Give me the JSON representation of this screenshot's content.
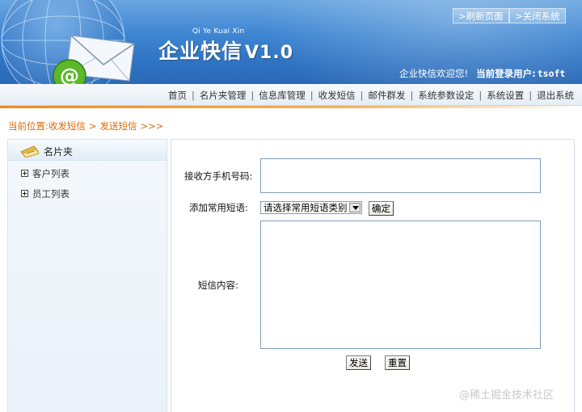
{
  "header": {
    "logo_pinyin": "Qi Ye Kuai Xin",
    "logo_title": "企业快信",
    "logo_version": "V1.0",
    "refresh_label": ">刷新页面",
    "close_label": ">关闭系统",
    "welcome_text": "企业快信欢迎您!",
    "login_label": "当前登录用户:",
    "username": "tsoft",
    "icons": [
      "globe-icon",
      "envelope-icon",
      "at-sign-icon"
    ]
  },
  "nav": {
    "items": [
      "首页",
      "名片夹管理",
      "信息库管理",
      "收发短信",
      "邮件群发",
      "系统参数设定",
      "系统设置",
      "退出系统"
    ],
    "separator": "|"
  },
  "breadcrumb": {
    "prefix": "当前位置:",
    "level1": "收发短信",
    "sep": ">",
    "level2": "发送短信",
    "suffix": ">>>"
  },
  "sidebar": {
    "title": "名片夹",
    "items": [
      {
        "label": "客户列表",
        "icon": "plus-box-icon"
      },
      {
        "label": "员工列表",
        "icon": "plus-box-icon"
      }
    ]
  },
  "form": {
    "receiver_label": "接收方手机号码:",
    "receiver_value": "",
    "phrase_label": "添加常用短语:",
    "phrase_selected": "请选择常用短语类别",
    "confirm_label": "确定",
    "content_label": "短信内容:",
    "content_value": "",
    "send_label": "发送",
    "reset_label": "重置"
  },
  "watermark": "@稀土掘金技术社区",
  "colors": {
    "banner_blue": "#3f86d2",
    "accent_orange": "#e06a00",
    "nav_bg": "#e6eef6"
  }
}
